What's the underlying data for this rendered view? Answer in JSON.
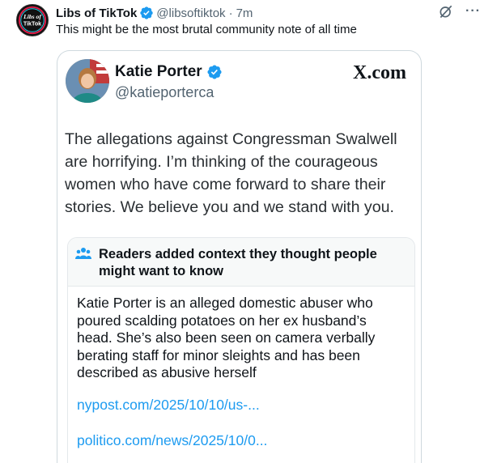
{
  "tweet": {
    "author_name": "Libs of TikTok",
    "handle": "@libsoftiktok",
    "separator": "·",
    "time": "7m",
    "text": "This might be the most brutal community note of all time",
    "avatar_text": "Libs of TikTok",
    "more_label": "···"
  },
  "card": {
    "author_name": "Katie Porter",
    "handle": "@katieporterca",
    "site": "X.com",
    "text": "The allegations against Congressman Swalwell are horrifying. I’m thinking of the courageous women who have come forward to share their stories. We believe you and we stand with you.",
    "note": {
      "title": "Readers added context they thought people might want to know",
      "body": "Katie Porter is an alleged domestic abuser who poured scalding potatoes on her ex husband’s head. She’s also been seen on camera verbally berating staff for minor sleights and has been described as abusive herself",
      "links": [
        "nypost.com/2025/10/10/us-...",
        "politico.com/news/2025/10/0..."
      ]
    }
  },
  "colors": {
    "verified_blue": "#1d9bf0",
    "link_blue": "#1d9bf0",
    "secondary_text": "#536471",
    "border": "#cfd9de"
  },
  "icons": [
    "verified-badge-icon",
    "grok-icon",
    "more-icon",
    "people-icon",
    "x-logo"
  ]
}
